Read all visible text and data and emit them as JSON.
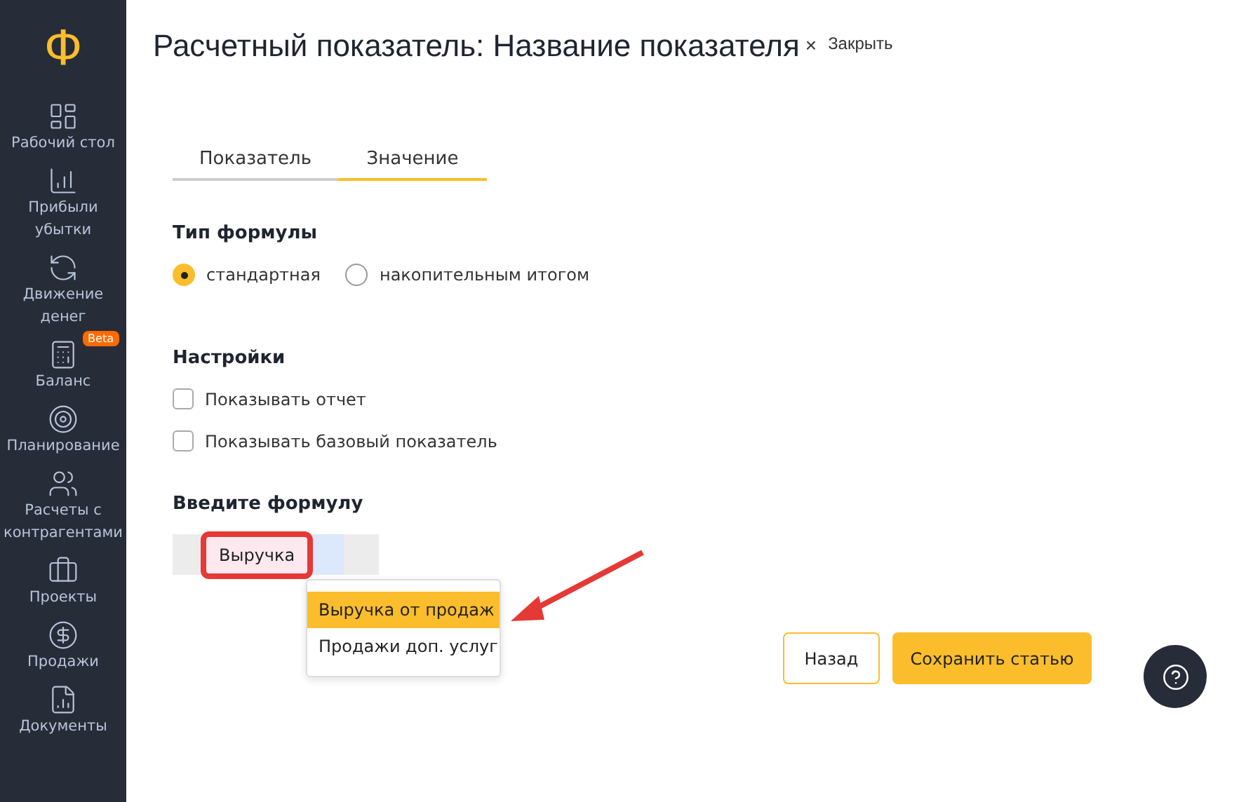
{
  "sidebar": {
    "logo": "Ф",
    "items": [
      {
        "label": "Рабочий стол"
      },
      {
        "label": "Прибыли убытки"
      },
      {
        "label": "Движение денег"
      },
      {
        "label": "Баланс",
        "badge": "Beta"
      },
      {
        "label": "Планирование"
      },
      {
        "label": "Расчеты с контрагентами"
      },
      {
        "label": "Проекты"
      },
      {
        "label": "Продажи"
      },
      {
        "label": "Документы"
      }
    ]
  },
  "header": {
    "title": "Расчетный показатель: Название показателя",
    "close_icon": "×",
    "close_label": "Закрыть"
  },
  "tabs": [
    {
      "label": "Показатель",
      "selected": false
    },
    {
      "label": "Значение",
      "selected": true
    }
  ],
  "formula_type": {
    "heading": "Тип формулы",
    "options": [
      {
        "label": "стандартная",
        "selected": true
      },
      {
        "label": "накопительным итогом",
        "selected": false
      }
    ]
  },
  "settings": {
    "heading": "Настройки",
    "options": [
      {
        "label": "Показывать отчет",
        "checked": false
      },
      {
        "label": "Показывать базовый показатель",
        "checked": false
      }
    ]
  },
  "formula": {
    "heading": "Введите формулу",
    "token": "Выручка",
    "suggestions": [
      {
        "label": "Выручка от продаж",
        "selected": true
      },
      {
        "label": "Продажи доп. услуг",
        "selected": false
      }
    ]
  },
  "buttons": {
    "back": "Назад",
    "save": "Сохранить статью"
  }
}
